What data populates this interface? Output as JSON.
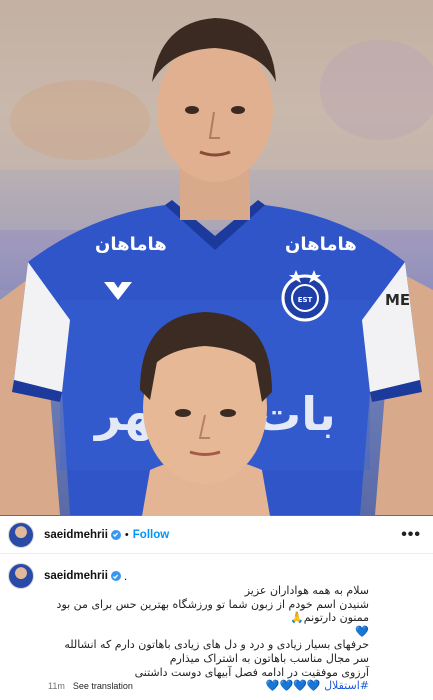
{
  "post": {
    "username": "saeidmehrii",
    "follow_label": "Follow",
    "separator": "•",
    "more_label": "•••"
  },
  "caption": {
    "username": "saeidmehrii",
    "trailing_dot": ".",
    "lines": [
      "سلام به همه هواداران عزیز",
      "شنیدن اسم خودم از زبون شما تو ورزشگاه بهترین حس برای من بود",
      "ممنون دارتونم🙏",
      "💙",
      "حرفهای بسیار زیادی و درد و دل های زیادی باهاتون دارم که انشالله",
      "سر مجال مناسب باهاتون به اشتراک میذارم",
      "آرزوی موفقیت در ادامه فصل آبیهای دوست داشتنی",
      "#استقلال 💙💙💙💙"
    ]
  },
  "meta": {
    "time": "11m",
    "see_translation": "See translation"
  },
  "photo": {
    "sponsor_text": "هاماهان",
    "chest_text": "باشهر",
    "badge_text": "ESTEGHLAL",
    "kit_color": "#2f55c8",
    "accent_color": "#ffffff"
  },
  "colors": {
    "follow": "#0095f6",
    "verified": "#3897f0"
  }
}
